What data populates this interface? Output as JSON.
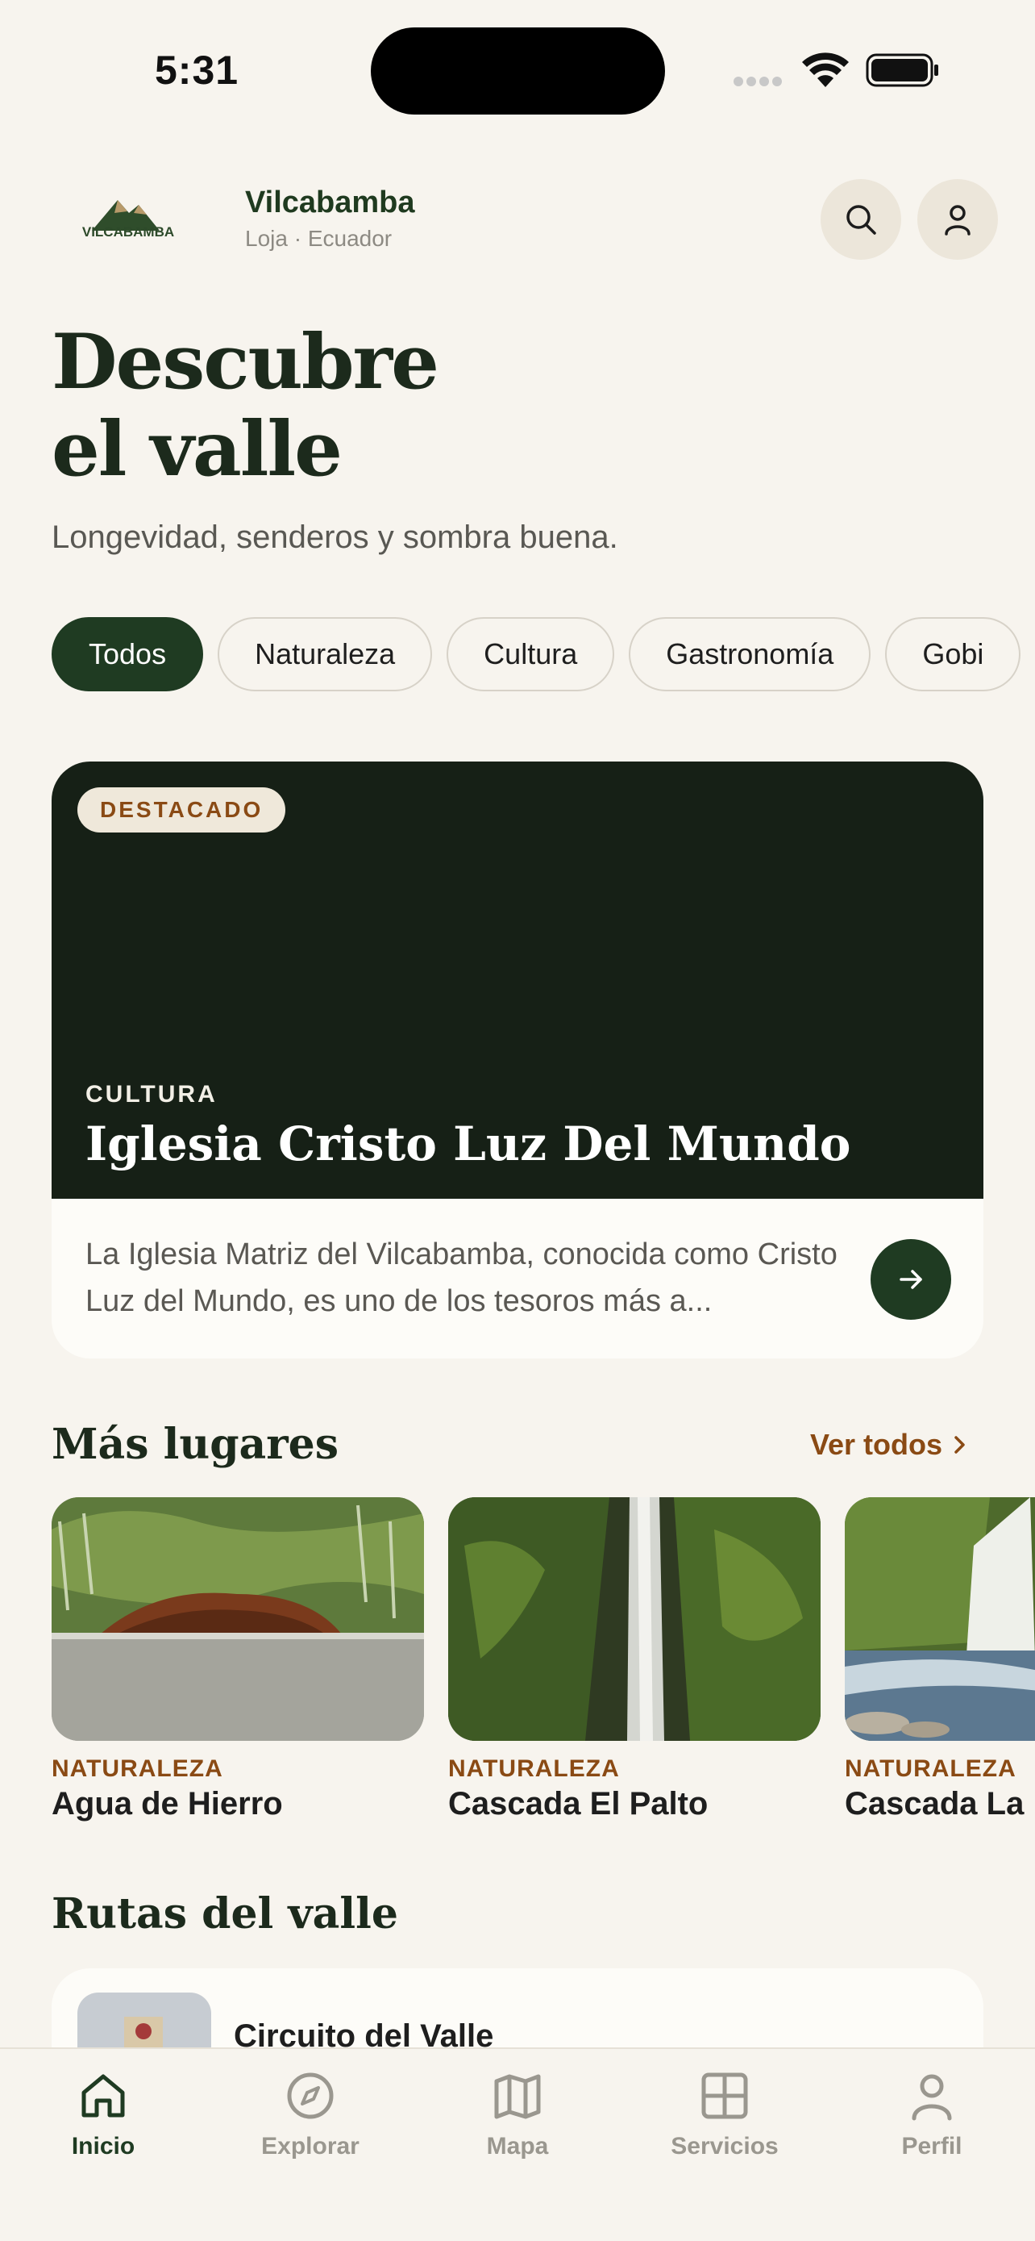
{
  "status_bar": {
    "time": "5:31"
  },
  "header": {
    "logo_text": "VILCABAMBA",
    "title": "Vilcabamba",
    "subtitle": "Loja · Ecuador"
  },
  "hero": {
    "title_line1": "Descubre",
    "title_line2": "el valle",
    "subtitle": "Longevidad, senderos y sombra buena."
  },
  "chips": [
    {
      "label": "Todos",
      "active": true
    },
    {
      "label": "Naturaleza",
      "active": false
    },
    {
      "label": "Cultura",
      "active": false
    },
    {
      "label": "Gastronomía",
      "active": false
    },
    {
      "label": "Gobi",
      "active": false
    }
  ],
  "featured": {
    "badge": "DESTACADO",
    "category": "CULTURA",
    "title": "Iglesia Cristo Luz Del Mundo",
    "description": "La Iglesia Matriz del Vilcabamba, conocida como Cristo Luz del Mundo, es uno de los tesoros más a..."
  },
  "more_places": {
    "title": "Más lugares",
    "see_all": "Ver todos",
    "items": [
      {
        "category": "NATURALEZA",
        "name": "Agua de Hierro"
      },
      {
        "category": "NATURALEZA",
        "name": "Cascada El Palto"
      },
      {
        "category": "NATURALEZA",
        "name": "Cascada La I"
      }
    ]
  },
  "routes": {
    "title": "Rutas del valle",
    "items": [
      {
        "name": "Circuito del Valle"
      }
    ]
  },
  "tabbar": [
    {
      "label": "Inicio",
      "icon": "home-icon",
      "active": true
    },
    {
      "label": "Explorar",
      "icon": "compass-icon",
      "active": false
    },
    {
      "label": "Mapa",
      "icon": "map-icon",
      "active": false
    },
    {
      "label": "Servicios",
      "icon": "grid-icon",
      "active": false
    },
    {
      "label": "Perfil",
      "icon": "person-icon",
      "active": false
    }
  ],
  "colors": {
    "background": "#f7f4ee",
    "primary_green": "#1f3b22",
    "accent_brown": "#8a4a14",
    "featured_dark": "#162016"
  }
}
